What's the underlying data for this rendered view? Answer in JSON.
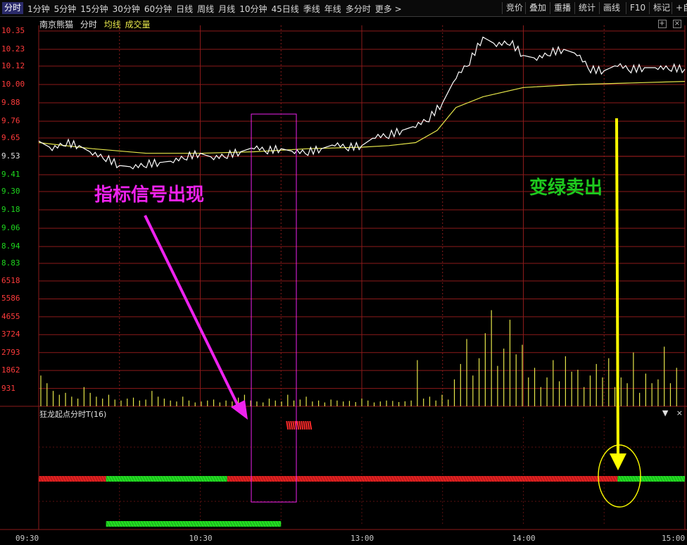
{
  "toolbar": {
    "tabs": [
      "分时",
      "1分钟",
      "5分钟",
      "15分钟",
      "30分钟",
      "60分钟",
      "日线",
      "周线",
      "月线",
      "10分钟",
      "45日线",
      "季线",
      "年线",
      "多分时",
      "更多 >"
    ],
    "active_tab": "分时",
    "right_tools": [
      "竞价",
      "叠加",
      "重播",
      "统计",
      "画线",
      "F10",
      "标记",
      "+自"
    ]
  },
  "header": {
    "stock_name": "南京熊猫",
    "mode": "分时",
    "avg_label": "均线",
    "vol_label": "成交量"
  },
  "header_icons": [
    "+",
    "×"
  ],
  "price_axis": [
    "10.35",
    "10.23",
    "10.12",
    "10.00",
    "9.88",
    "9.76",
    "9.65",
    "9.53",
    "9.41",
    "9.30",
    "9.18",
    "9.06",
    "8.94",
    "8.83"
  ],
  "volume_axis": [
    "6518",
    "5586",
    "4655",
    "3724",
    "2793",
    "1862",
    "931"
  ],
  "time_axis": [
    "09:30",
    "10:30",
    "13:00",
    "14:00",
    "15:00"
  ],
  "indicator": {
    "title": "狂龙起点分时T(16)",
    "icons": [
      "▼",
      "×"
    ]
  },
  "annotations": {
    "signal_text": "指标信号出现",
    "sell_text": "变绿卖出"
  },
  "colors": {
    "up": "#ff3b3b",
    "down": "#1ed81e",
    "price_line": "#ffffff",
    "avg_line": "#e6e64a",
    "volume": "#e6e64a",
    "grid": "#8b1a1a",
    "magenta": "#ee22ee",
    "yellow": "#ffff00"
  },
  "chart_data": {
    "type": "line",
    "x_range": [
      "09:30",
      "15:00"
    ],
    "ylim": [
      8.83,
      10.35
    ],
    "series": [
      {
        "points": [
          [
            0,
            9.63
          ],
          [
            5,
            9.58
          ],
          [
            10,
            9.62
          ],
          [
            15,
            9.6
          ],
          [
            20,
            9.55
          ],
          [
            25,
            9.52
          ],
          [
            30,
            9.47
          ],
          [
            35,
            9.46
          ],
          [
            40,
            9.48
          ],
          [
            45,
            9.49
          ],
          [
            50,
            9.5
          ],
          [
            55,
            9.53
          ],
          [
            60,
            9.55
          ],
          [
            65,
            9.52
          ],
          [
            70,
            9.54
          ],
          [
            75,
            9.56
          ],
          [
            80,
            9.59
          ],
          [
            85,
            9.57
          ],
          [
            90,
            9.58
          ],
          [
            95,
            9.56
          ],
          [
            100,
            9.56
          ],
          [
            105,
            9.58
          ],
          [
            110,
            9.61
          ],
          [
            115,
            9.59
          ],
          [
            120,
            9.6
          ],
          [
            125,
            9.66
          ],
          [
            130,
            9.67
          ],
          [
            135,
            9.7
          ],
          [
            140,
            9.73
          ],
          [
            145,
            9.78
          ],
          [
            150,
            9.88
          ],
          [
            155,
            10.05
          ],
          [
            160,
            10.15
          ],
          [
            165,
            10.31
          ],
          [
            170,
            10.26
          ],
          [
            175,
            10.28
          ],
          [
            180,
            10.19
          ],
          [
            185,
            10.17
          ],
          [
            190,
            10.21
          ],
          [
            195,
            10.23
          ],
          [
            200,
            10.2
          ],
          [
            205,
            10.1
          ],
          [
            210,
            10.09
          ],
          [
            215,
            10.13
          ],
          [
            220,
            10.1
          ],
          [
            225,
            10.11
          ],
          [
            230,
            10.11
          ],
          [
            235,
            10.11
          ],
          [
            240,
            10.1
          ]
        ]
      },
      {
        "points": [
          [
            0,
            9.62
          ],
          [
            20,
            9.58
          ],
          [
            40,
            9.55
          ],
          [
            60,
            9.55
          ],
          [
            80,
            9.56
          ],
          [
            100,
            9.58
          ],
          [
            120,
            9.59
          ],
          [
            130,
            9.6
          ],
          [
            140,
            9.62
          ],
          [
            148,
            9.7
          ],
          [
            155,
            9.85
          ],
          [
            165,
            9.92
          ],
          [
            180,
            9.98
          ],
          [
            200,
            10.0
          ],
          [
            220,
            10.01
          ],
          [
            240,
            10.02
          ]
        ]
      }
    ],
    "volume": {
      "ylim": [
        0,
        6518
      ],
      "approx_values": [
        1600,
        1200,
        800,
        600,
        700,
        500,
        400,
        1000,
        700,
        500,
        400,
        600,
        350,
        300,
        400,
        450,
        300,
        350,
        800,
        500,
        400,
        300,
        250,
        500,
        300,
        200,
        250,
        300,
        350,
        200,
        300,
        250,
        450,
        600,
        300,
        250,
        200,
        400,
        300,
        250,
        600,
        300,
        350,
        500,
        250,
        300,
        200,
        350,
        300,
        250,
        280,
        220,
        400,
        300,
        200,
        250,
        300,
        280,
        220,
        260,
        300,
        2400,
        400,
        500,
        300,
        600,
        350,
        1400,
        2200,
        3500,
        1600,
        2500,
        3800,
        5000,
        2100,
        3000,
        4500,
        2700,
        3200,
        1500,
        2000,
        1000,
        1500,
        2400,
        1300,
        2600,
        1800,
        1900,
        1000,
        1600,
        2200,
        1500,
        2500,
        1000,
        1500,
        1200,
        2800,
        700,
        1700,
        1200,
        1400,
        3100,
        1200,
        2000
      ]
    },
    "indicator_bars": {
      "main_band": [
        {
          "from": "09:30",
          "to": "09:55",
          "color": "red"
        },
        {
          "from": "09:55",
          "to": "10:40",
          "color": "green"
        },
        {
          "from": "10:40",
          "to": "14:35",
          "color": "red"
        },
        {
          "from": "14:35",
          "to": "15:00",
          "color": "green"
        }
      ],
      "signal_marks": {
        "from": "11:00",
        "to": "11:05",
        "color": "red"
      },
      "lower_band": {
        "from": "09:55",
        "to": "11:00",
        "color": "green"
      }
    }
  }
}
